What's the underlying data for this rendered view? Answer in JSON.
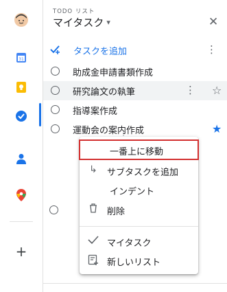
{
  "colors": {
    "accent": "#1a73e8",
    "highlight_border": "#d32f2f"
  },
  "rail": {
    "icons": [
      "avatar",
      "calendar-icon",
      "keep-icon",
      "tasks-icon",
      "contacts-icon",
      "maps-icon",
      "plus-icon"
    ]
  },
  "header": {
    "subtitle": "TODO リスト",
    "title": "マイタスク",
    "dropdown_glyph": "▾",
    "close_glyph": "✕"
  },
  "add_task": {
    "label": "タスクを追加",
    "icon": "add-task-icon"
  },
  "tasks": [
    {
      "title": "助成金申請書類作成"
    },
    {
      "title": "研究論文の執筆"
    },
    {
      "title": "指導案作成"
    },
    {
      "title": "運動会の案内作成"
    }
  ],
  "menu": {
    "items": [
      {
        "label": "一番上に移動",
        "icon": ""
      },
      {
        "label": "サブタスクを追加",
        "icon": "subtask-icon"
      },
      {
        "label": "インデント",
        "icon": ""
      },
      {
        "label": "削除",
        "icon": "trash-icon"
      },
      {
        "label": "マイタスク",
        "icon": "check-icon"
      },
      {
        "label": "新しいリスト",
        "icon": "new-list-icon"
      }
    ]
  }
}
